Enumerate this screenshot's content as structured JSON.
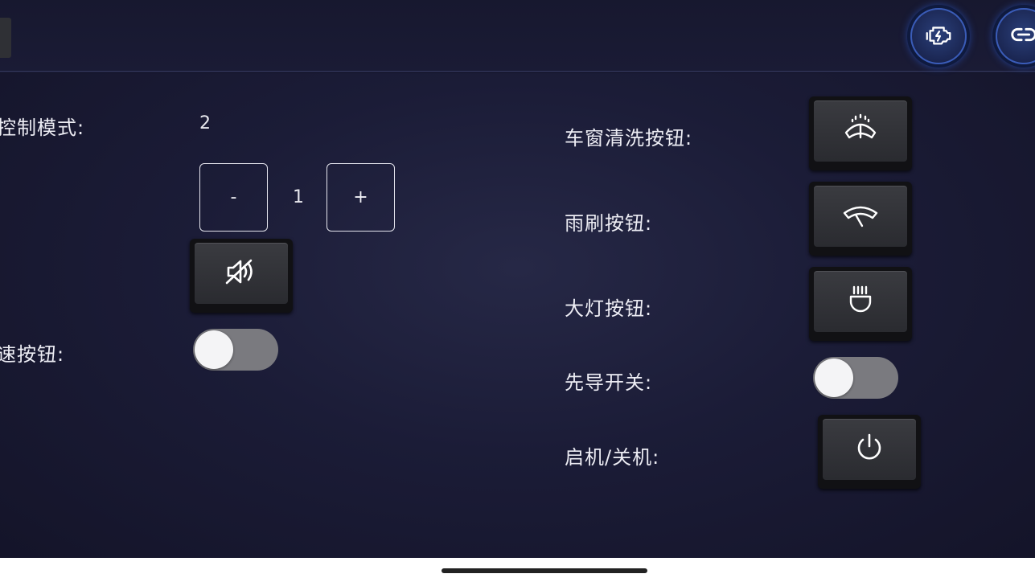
{
  "header": {
    "icons": [
      "engine-warning-icon",
      "link-icon"
    ]
  },
  "left": {
    "control_mode_label": "控制模式:",
    "control_mode_value": "2",
    "stepper": {
      "minus_label": "-",
      "value": "1",
      "plus_label": "+"
    },
    "mute_icon": "speaker-mute-icon",
    "speed_label": "速按钮:",
    "speed_toggle_on": false
  },
  "right": {
    "washer_label": "车窗清洗按钮:",
    "washer_icon": "windshield-washer-icon",
    "wiper_label": "雨刷按钮:",
    "wiper_icon": "wiper-icon",
    "headlight_label": "大灯按钮:",
    "headlight_icon": "headlight-icon",
    "pilot_label": "先导开关:",
    "pilot_toggle_on": false,
    "power_label": "启机/关机:",
    "power_icon": "power-icon"
  },
  "colors": {
    "background": "#1b1c37",
    "accent_blue": "#3a5cb8",
    "toggle_off": "#7a7a7f"
  }
}
